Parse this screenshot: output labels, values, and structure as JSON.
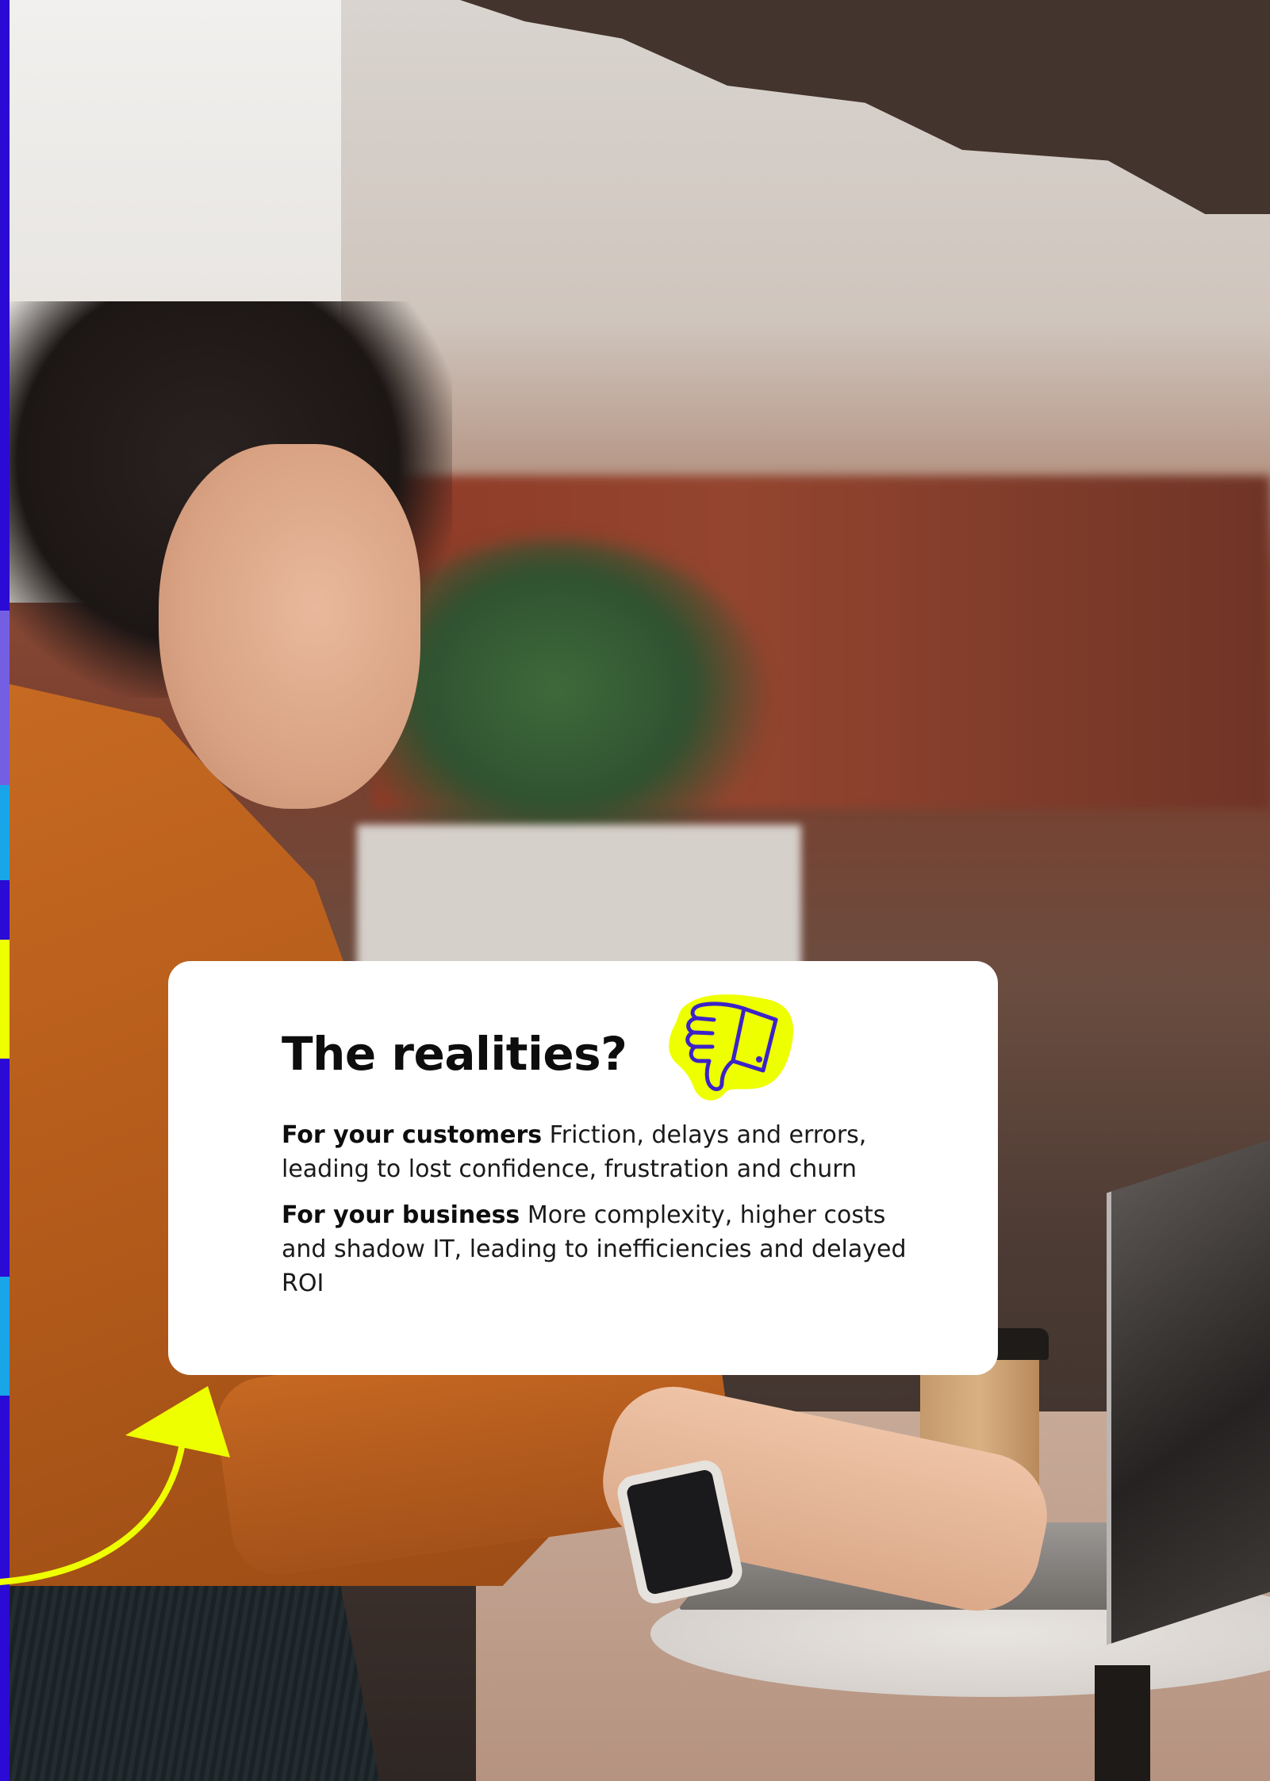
{
  "card": {
    "title": "The realities?",
    "items": [
      {
        "lead": "For your customers",
        "text": "Friction, delays and errors, leading to lost confidence, frustration and churn"
      },
      {
        "lead": "For your business",
        "text": "More complexity, higher costs and shadow IT, leading to inefficiencies and delayed ROI"
      }
    ],
    "icon": "thumbs-down-icon"
  },
  "colors": {
    "card_bg": "#ffffff",
    "accent_yellow": "#eeff00",
    "accent_blue": "#2a0ad4",
    "accent_cyan": "#18a6e8",
    "text_dark": "#0d0d0d"
  }
}
